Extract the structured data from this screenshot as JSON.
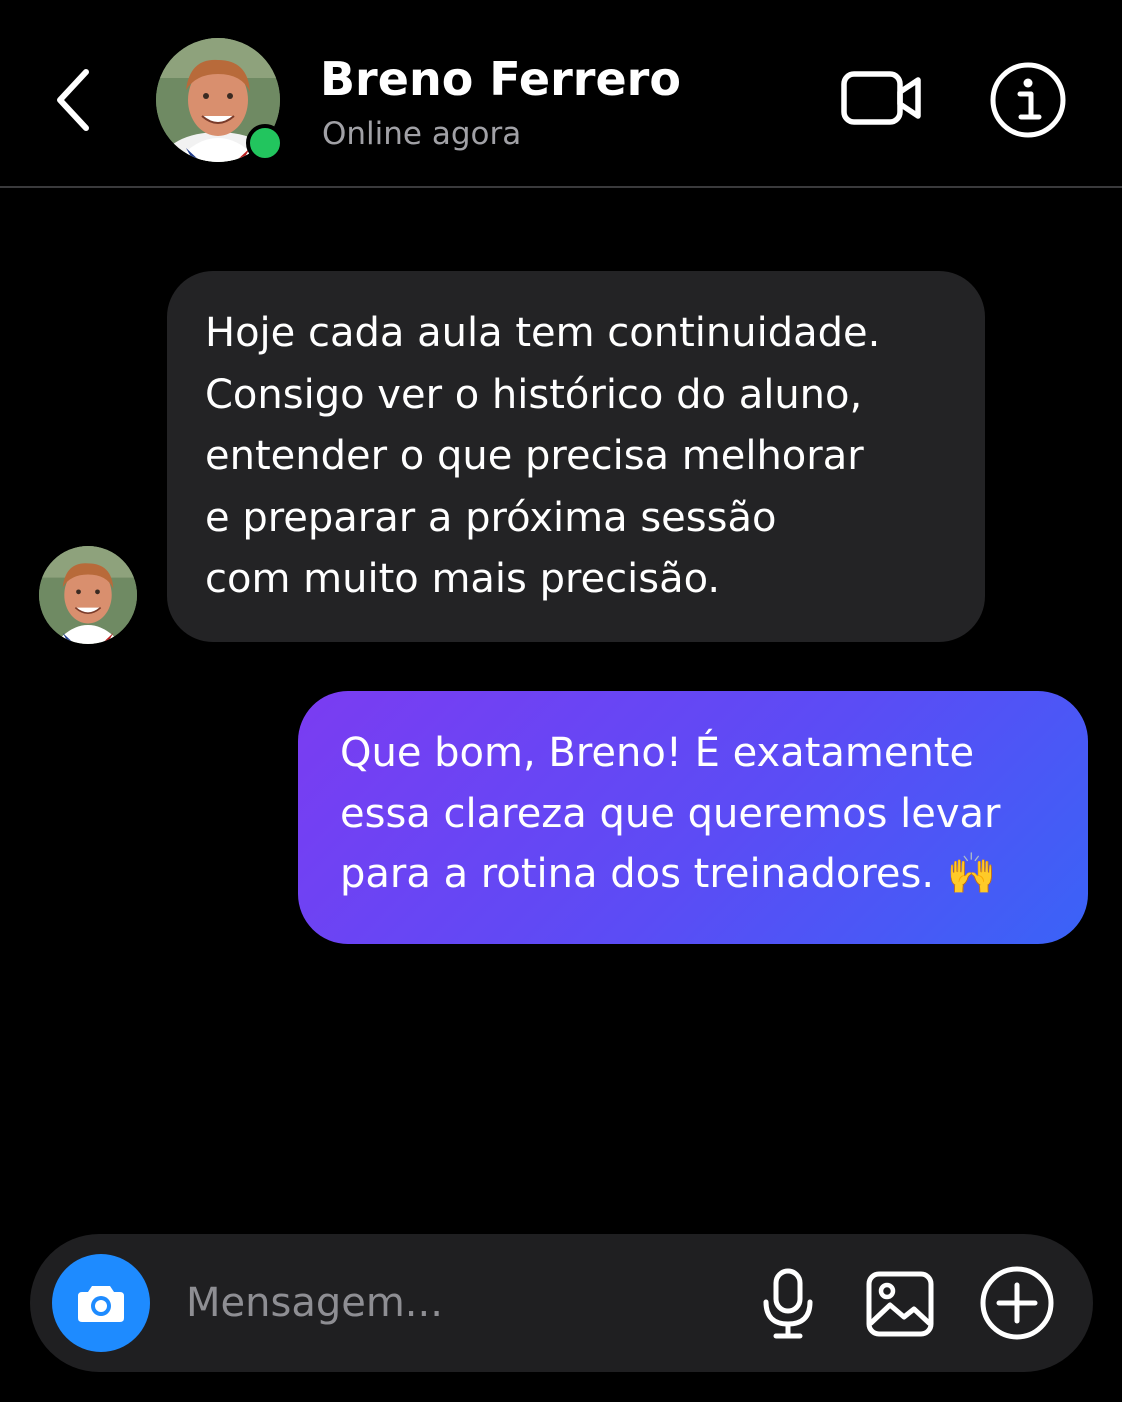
{
  "header": {
    "contact_name": "Breno Ferrero",
    "status": "Online agora",
    "online_color": "#22c55e",
    "icons": {
      "back": "chevron-left-icon",
      "video": "video-camera-icon",
      "info": "info-icon"
    }
  },
  "messages": [
    {
      "direction": "incoming",
      "sender": "Breno Ferrero",
      "text": "Hoje cada aula tem continuidade.\nConsigo ver o histórico do aluno,\nentender o que precisa melhorar\ne preparar a próxima sessão\ncom muito mais precisão."
    },
    {
      "direction": "outgoing",
      "text": "Que bom, Breno! É exatamente\nessa clareza que queremos levar\npara a rotina dos treinadores. 🙌"
    }
  ],
  "composer": {
    "placeholder": "Mensagem...",
    "value": "",
    "icons": {
      "camera": "camera-icon",
      "mic": "microphone-icon",
      "gallery": "image-icon",
      "plus": "plus-circle-icon"
    }
  },
  "colors": {
    "background": "#000000",
    "incoming_bubble": "#232325",
    "outgoing_gradient_start": "#7b3cf2",
    "outgoing_gradient_end": "#3a63f7",
    "camera_button": "#1e8bff"
  }
}
